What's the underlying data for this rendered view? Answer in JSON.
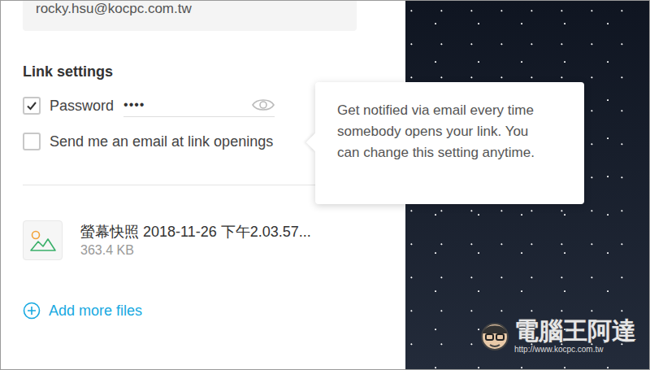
{
  "email_field": {
    "value": "rocky.hsu@kocpc.com.tw"
  },
  "link_settings": {
    "title": "Link settings",
    "options": [
      {
        "label": "Password",
        "checked": true,
        "kind": "password",
        "value": "••••"
      },
      {
        "label": "Send me an email at link openings",
        "checked": false,
        "kind": "toggle"
      }
    ]
  },
  "tooltip": {
    "text": "Get notified via email every time somebody opens your link. You can change this setting anytime."
  },
  "files": [
    {
      "name": "螢幕快照 2018-11-26 下午2.03.57...",
      "size": "363.4 KB"
    }
  ],
  "add_files": {
    "label": "Add more files"
  },
  "watermark": {
    "title": "電腦王阿達",
    "url": "http://www.kocpc.com.tw"
  }
}
